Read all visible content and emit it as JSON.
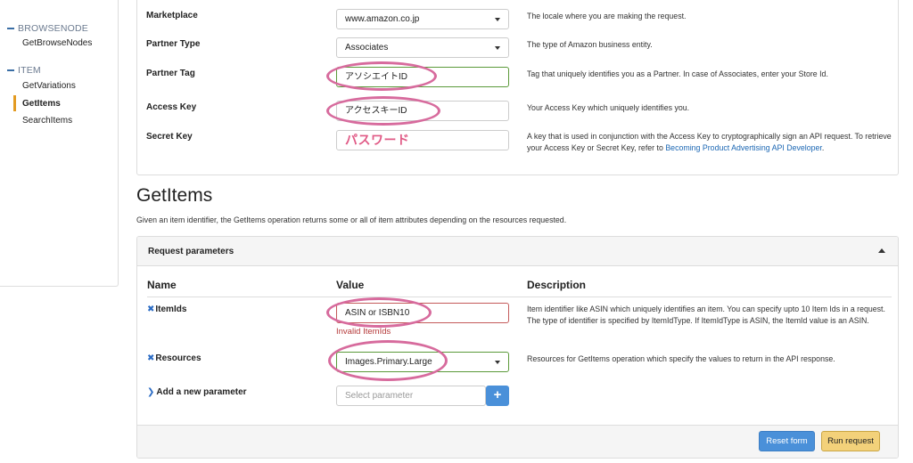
{
  "sidebar": {
    "section1": "BROWSENODE",
    "section1_items": [
      "GetBrowseNodes"
    ],
    "section2": "ITEM",
    "section2_items": [
      "GetVariations",
      "GetItems",
      "SearchItems"
    ]
  },
  "credentials": {
    "marketplace": {
      "label": "Marketplace",
      "value": "www.amazon.co.jp",
      "desc": "The locale where you are making the request."
    },
    "partner_type": {
      "label": "Partner Type",
      "value": "Associates",
      "desc": "The type of Amazon business entity."
    },
    "partner_tag": {
      "label": "Partner Tag",
      "value": "アソシエイトID",
      "desc": "Tag that uniquely identifies you as a Partner. In case of Associates, enter your Store Id."
    },
    "access_key": {
      "label": "Access Key",
      "value": "アクセスキーID",
      "desc": "Your Access Key which uniquely identifies you."
    },
    "secret_key": {
      "label": "Secret Key",
      "value": "パスワード",
      "desc_prefix": "A key that is used in conjunction with the Access Key to cryptographically sign an API request. To retrieve your Access Key or Secret Key, refer to ",
      "desc_link": "Becoming Product Advertising API Developer",
      "desc_suffix": "."
    }
  },
  "getitems": {
    "title": "GetItems",
    "intro": "Given an item identifier, the GetItems operation returns some or all of item attributes depending on the resources requested.",
    "panel_title": "Request parameters",
    "col_name": "Name",
    "col_value": "Value",
    "col_desc": "Description",
    "itemids": {
      "label": "ItemIds",
      "value": "ASIN or ISBN10",
      "error": "Invalid ItemIds",
      "desc": "Item identifier like ASIN which uniquely identifies an item. You can specify upto 10 Item Ids in a request. The type of identifier is specified by ItemIdType. If ItemIdType is ASIN, the ItemId value is an ASIN."
    },
    "resources": {
      "label": "Resources",
      "value": "Images.Primary.Large",
      "desc": "Resources for GetItems operation which specify the values to return in the API response."
    },
    "add_param": {
      "label": "Add a new parameter",
      "placeholder": "Select parameter",
      "plus": "+"
    },
    "reset_label": "Reset form",
    "run_label": "Run request"
  },
  "colors": {
    "accent": "#4a90d9",
    "run": "#f3d17a",
    "highlight": "#d76b9d",
    "error": "#b53a3a"
  }
}
